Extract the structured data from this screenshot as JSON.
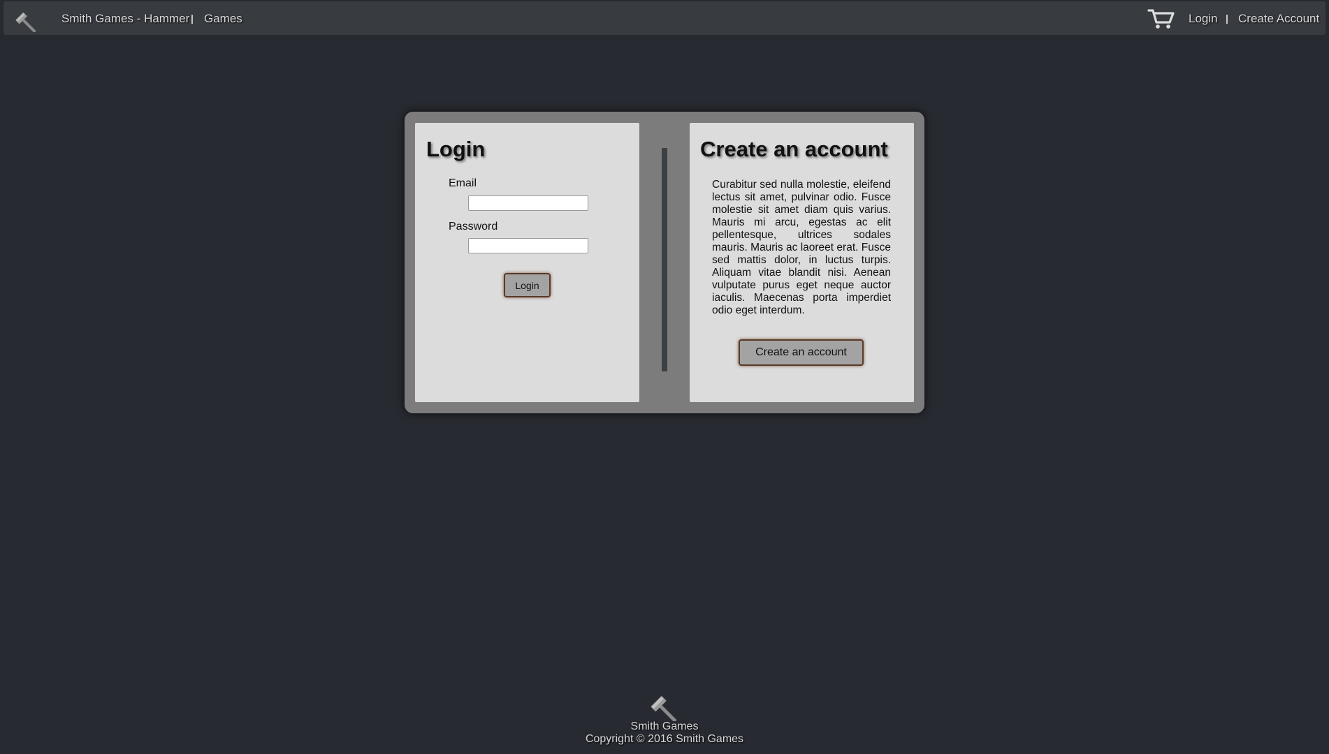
{
  "nav": {
    "brand": "Smith Games - Hammer",
    "separator": "|",
    "games": "Games",
    "login": "Login",
    "create_account": "Create Account"
  },
  "login_card": {
    "title": "Login",
    "email_label": "Email",
    "email_value": "",
    "password_label": "Password",
    "password_value": "",
    "button": "Login"
  },
  "create_card": {
    "title": "Create an account",
    "description": "Curabitur sed nulla molestie, eleifend lectus sit amet, pulvinar odio. Fusce molestie sit amet diam quis varius. Mauris mi arcu, egestas ac elit pellentesque, ultrices sodales mauris. Mauris ac laoreet erat. Fusce sed mattis dolor, in luctus turpis. Aliquam vitae blandit nisi. Aenean vulputate purus eget neque auctor iaculis. Maecenas porta imperdiet odio eget interdum.",
    "button": "Create an account"
  },
  "footer": {
    "name": "Smith Games",
    "copyright": "Copyright © 2016 Smith Games"
  },
  "icons": {
    "logo": "hammer-icon",
    "cart": "cart-icon"
  },
  "colors": {
    "background": "#272a30",
    "navbar": "#383b40",
    "panel": "#7c7c7c",
    "card": "#dcdcdc",
    "button": "#a3a3a3",
    "button_border": "#5a3a2a"
  }
}
